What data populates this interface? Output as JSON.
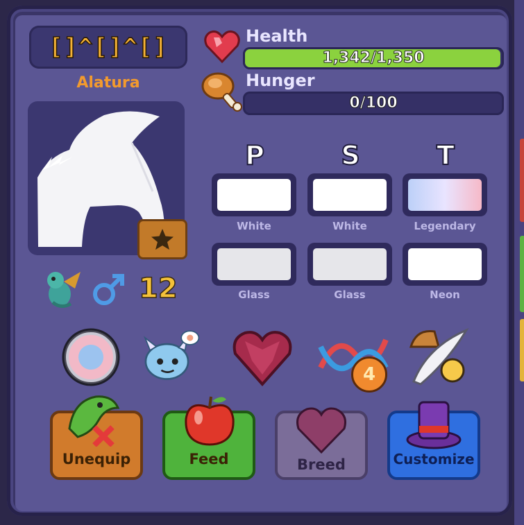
{
  "pet": {
    "nickname": "[]^[]^[]",
    "name": "Alatura",
    "level": "12",
    "gender_icon": "male-symbol-icon",
    "species_icon": "sea-dragon-icon"
  },
  "stats": {
    "health_label": "Health",
    "health_value": "1,342/1,350",
    "health_fraction": 0.994,
    "hunger_label": "Hunger",
    "hunger_value": "0/100",
    "hunger_fraction": 0.0
  },
  "columns": {
    "p": "P",
    "s": "S",
    "t": "T"
  },
  "traits": {
    "p_color": "White",
    "s_color": "White",
    "t_color": "Legendary",
    "p_material": "Glass",
    "s_material": "Glass",
    "t_material": "Neon"
  },
  "actions": {
    "unequip": "Unequip",
    "feed": "Feed",
    "breed": "Breed",
    "customize": "Customize"
  },
  "badges": {
    "dna_count": "4"
  },
  "colors": {
    "health_bar": "#8bd23e",
    "name_gold": "#f29a2e",
    "level_gold": "#f5c23a",
    "panel": "#5b5694"
  }
}
